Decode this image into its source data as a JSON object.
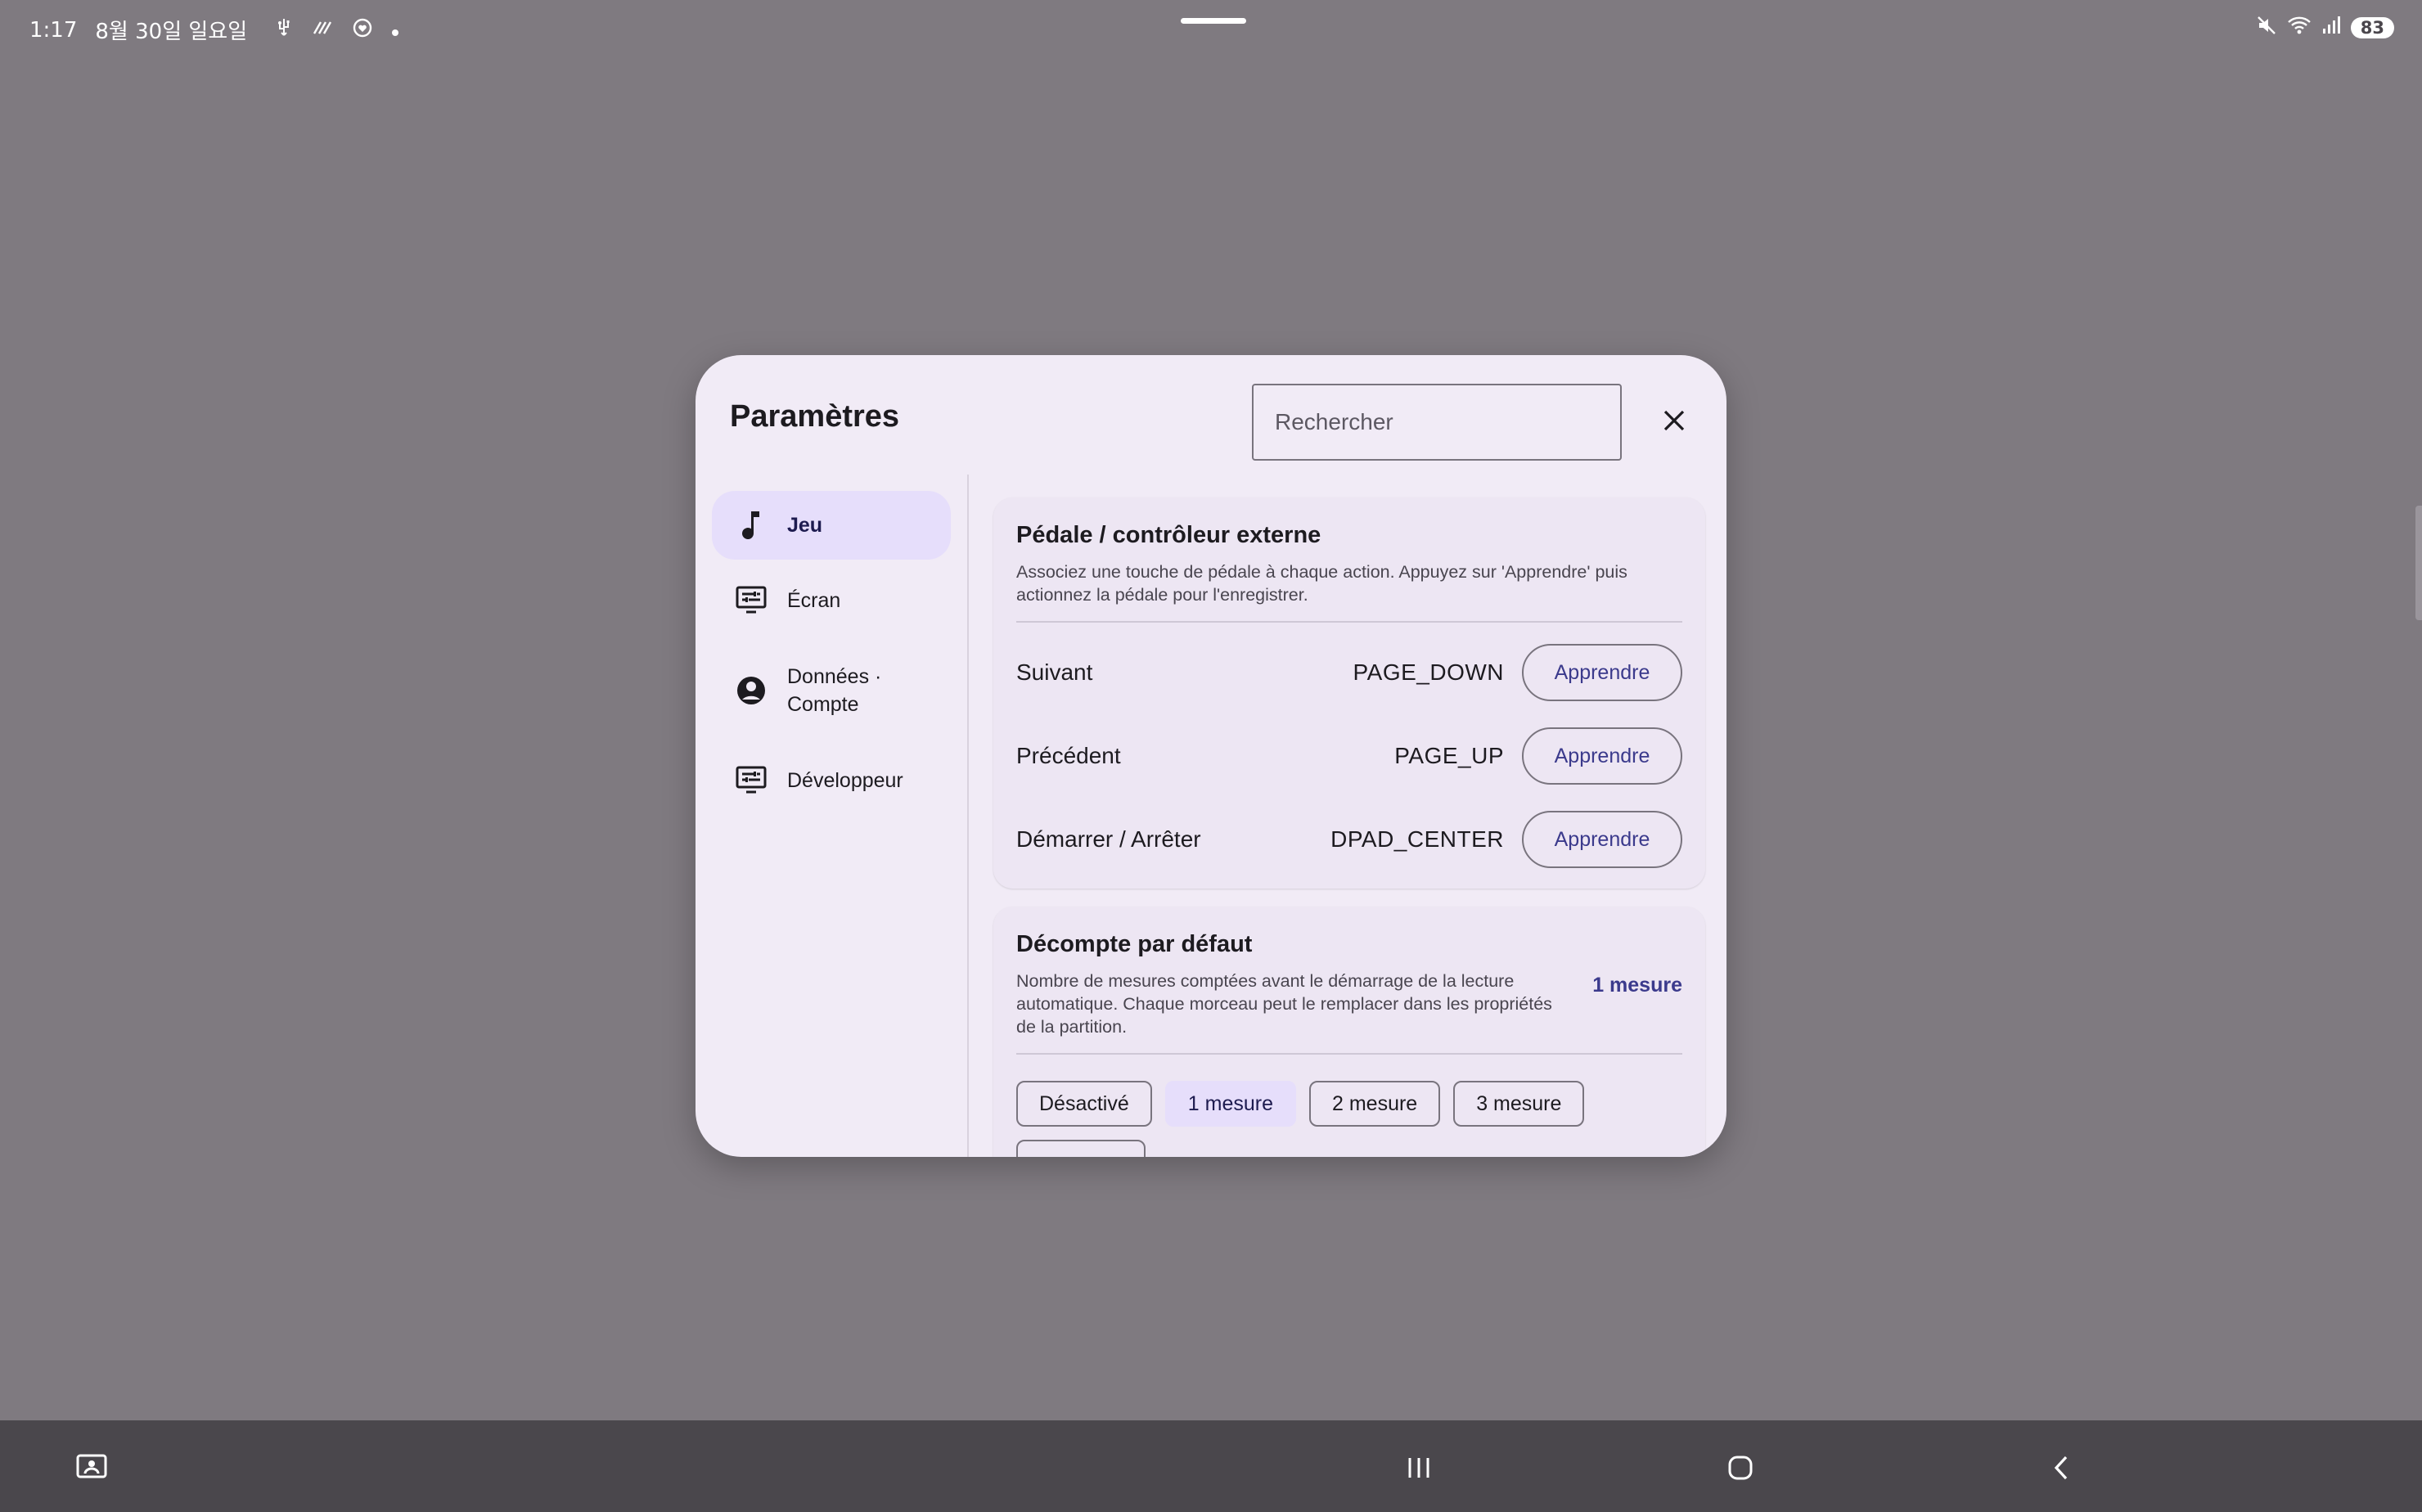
{
  "status_bar": {
    "time": "1:17",
    "date": "8월 30일 일요일",
    "battery": "83",
    "icons": [
      "usb-icon",
      "nfc-icon",
      "heart-shield-icon",
      "dot-icon",
      "mute-icon",
      "wifi-icon",
      "signal-icon",
      "battery-icon"
    ]
  },
  "dialog": {
    "title": "Paramètres",
    "search_placeholder": "Rechercher",
    "close_icon": "close-icon"
  },
  "sidebar": {
    "items": [
      {
        "label": "Jeu",
        "icon": "music-note-icon",
        "active": true
      },
      {
        "label": "Écran",
        "icon": "display-settings-icon",
        "active": false
      },
      {
        "label": "Données · Compte",
        "icon": "account-circle-icon",
        "active": false
      },
      {
        "label": "Développeur",
        "icon": "display-settings-icon",
        "active": false
      }
    ]
  },
  "pedal_card": {
    "title": "Pédale / contrôleur externe",
    "description": "Associez une touche de pédale à chaque action. Appuyez sur 'Apprendre' puis actionnez la pédale pour l'enregistrer.",
    "rows": [
      {
        "label": "Suivant",
        "key": "PAGE_DOWN",
        "button": "Apprendre"
      },
      {
        "label": "Précédent",
        "key": "PAGE_UP",
        "button": "Apprendre"
      },
      {
        "label": "Démarrer / Arrêter",
        "key": "DPAD_CENTER",
        "button": "Apprendre"
      }
    ]
  },
  "countdown_card": {
    "title": "Décompte par défaut",
    "description": "Nombre de mesures comptées avant le démarrage de la lecture automatique. Chaque morceau peut le remplacer dans les propriétés de la partition.",
    "value": "1 mesure",
    "chips": [
      {
        "label": "Désactivé",
        "selected": false
      },
      {
        "label": "1 mesure",
        "selected": true
      },
      {
        "label": "2 mesure",
        "selected": false
      },
      {
        "label": "3 mesure",
        "selected": false
      }
    ]
  },
  "colors": {
    "backdrop": "#7f7a80",
    "dialog_bg": "#f1ebf6",
    "card_bg": "#ede6f3",
    "accent": "#3b3a8c",
    "selected_bg": "#e6defb",
    "navbar_bg": "#4a474c"
  },
  "nav_bar": {
    "icons": [
      "screen-recorder-icon",
      "recents-icon",
      "home-icon",
      "back-icon"
    ]
  }
}
